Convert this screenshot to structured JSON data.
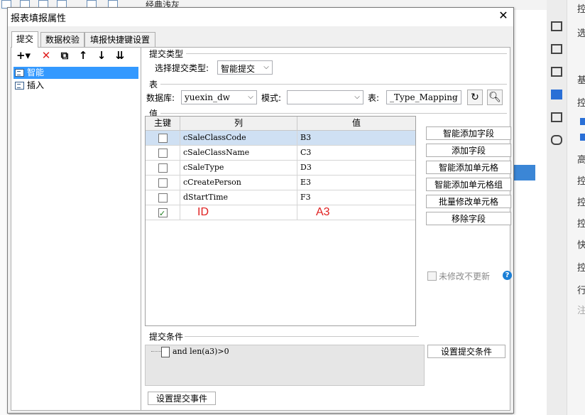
{
  "background": {
    "toolbar_text": "经典浅灰",
    "right_panel_labels": [
      "控",
      "选",
      "基",
      "控",
      "高",
      "控",
      "控",
      "控",
      "快",
      "控",
      "行",
      "注"
    ]
  },
  "dialog": {
    "title": "报表填报属性",
    "close_glyph": "✕",
    "tabs": [
      {
        "label": "提交"
      },
      {
        "label": "数据校验"
      },
      {
        "label": "填报快捷键设置"
      }
    ],
    "toolbar": {
      "add_glyph": "+▾",
      "delete_glyph": "✕",
      "copy_glyph": "⧉",
      "up_glyph": "↑",
      "down_glyph": "↓",
      "sort_glyph": "⇊"
    },
    "tree": [
      {
        "label": "智能",
        "selected": true
      },
      {
        "label": "插入",
        "selected": false
      }
    ],
    "submit_type": {
      "section": "提交类型",
      "label": "选择提交类型:",
      "value": "智能提交"
    },
    "table_section": {
      "section": "表",
      "db_label": "数据库:",
      "db_value": "yuexin_dw",
      "schema_label": "模式:",
      "schema_value": "",
      "table_label": "表:",
      "table_value": "_Type_Mapping"
    },
    "value_section": {
      "section": "值",
      "columns": {
        "key": "主键",
        "col": "列",
        "value": "值"
      },
      "rows": [
        {
          "key": false,
          "col": "cSaleClassCode",
          "value": "B3"
        },
        {
          "key": false,
          "col": "cSaleClassName",
          "value": "C3"
        },
        {
          "key": false,
          "col": "cSaleType",
          "value": "D3"
        },
        {
          "key": false,
          "col": "cCreatePerson",
          "value": "E3"
        },
        {
          "key": false,
          "col": "dStartTime",
          "value": "F3"
        },
        {
          "key": true,
          "col": "ID",
          "value": "A3"
        }
      ],
      "buttons": [
        "智能添加字段",
        "添加字段",
        "智能添加单元格",
        "智能添加单元格组",
        "批量修改单元格",
        "移除字段"
      ],
      "no_update_label": "未修改不更新",
      "help_glyph": "?"
    },
    "condition": {
      "section": "提交条件",
      "text": "and len(a3)>0",
      "button": "设置提交条件"
    },
    "event_button": "设置提交事件"
  }
}
